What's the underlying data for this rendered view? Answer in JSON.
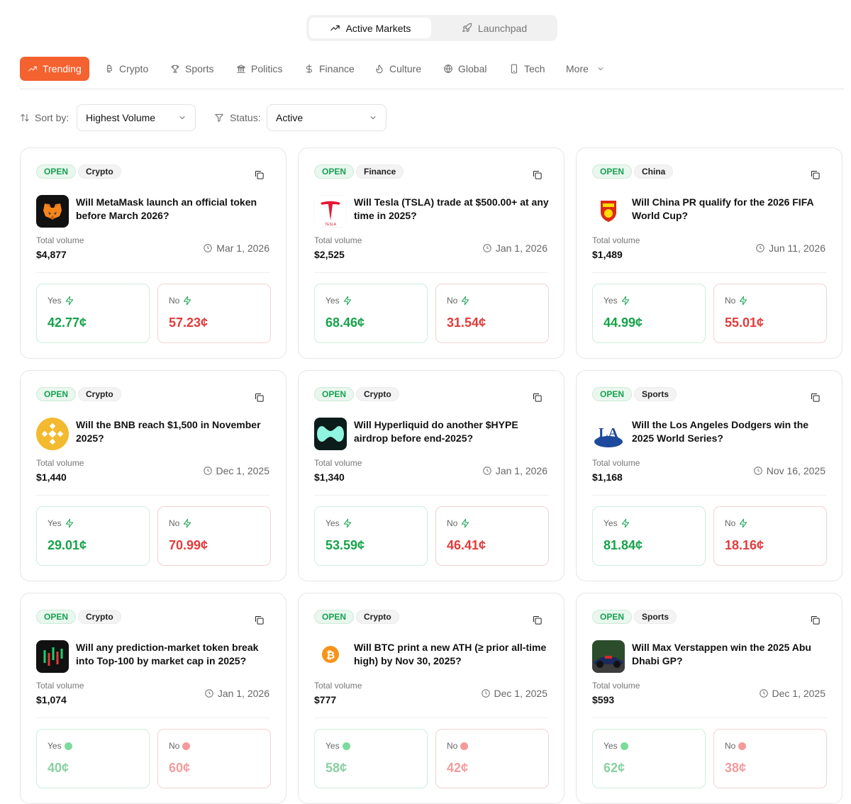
{
  "top_tabs": [
    {
      "label": "Active Markets",
      "icon": "trending-up-icon"
    },
    {
      "label": "Launchpad",
      "icon": "rocket-icon"
    }
  ],
  "categories": [
    {
      "label": "Trending",
      "icon": "trending-up-icon"
    },
    {
      "label": "Crypto",
      "icon": "bitcoin-icon"
    },
    {
      "label": "Sports",
      "icon": "trophy-icon"
    },
    {
      "label": "Politics",
      "icon": "landmark-icon"
    },
    {
      "label": "Finance",
      "icon": "dollar-icon"
    },
    {
      "label": "Culture",
      "icon": "flame-icon"
    },
    {
      "label": "Global",
      "icon": "globe-icon"
    },
    {
      "label": "Tech",
      "icon": "phone-icon"
    },
    {
      "label": "More",
      "icon": "chevron-down-icon"
    }
  ],
  "filters": {
    "sort_label": "Sort by:",
    "sort_value": "Highest Volume",
    "status_label": "Status:",
    "status_value": "Active"
  },
  "volume_label": "Total volume",
  "yes_label": "Yes",
  "no_label": "No",
  "colors": {
    "accent": "#f4622f",
    "yes": "#16a34a",
    "no": "#e23b3b"
  },
  "markets": [
    {
      "status": "OPEN",
      "category": "Crypto",
      "logo": "metamask-logo",
      "question": "Will MetaMask launch an official token before March 2026?",
      "volume": "$4,877",
      "date": "Mar 1, 2026",
      "yes": "42.77¢",
      "no": "57.23¢",
      "indicator": "bolt"
    },
    {
      "status": "OPEN",
      "category": "Finance",
      "logo": "tesla-logo",
      "question": "Will Tesla (TSLA) trade at $500.00+ at any time in 2025?",
      "volume": "$2,525",
      "date": "Jan 1, 2026",
      "yes": "68.46¢",
      "no": "31.54¢",
      "indicator": "bolt"
    },
    {
      "status": "OPEN",
      "category": "China",
      "logo": "china-fa-logo",
      "question": "Will China PR qualify for the 2026 FIFA World Cup?",
      "volume": "$1,489",
      "date": "Jun 11, 2026",
      "yes": "44.99¢",
      "no": "55.01¢",
      "indicator": "bolt"
    },
    {
      "status": "OPEN",
      "category": "Crypto",
      "logo": "bnb-logo",
      "question": "Will the BNB reach $1,500 in November 2025?",
      "volume": "$1,440",
      "date": "Dec 1, 2025",
      "yes": "29.01¢",
      "no": "70.99¢",
      "indicator": "bolt"
    },
    {
      "status": "OPEN",
      "category": "Crypto",
      "logo": "hyperliquid-logo",
      "question": "Will Hyperliquid do another $HYPE airdrop before end-2025?",
      "volume": "$1,340",
      "date": "Jan 1, 2026",
      "yes": "53.59¢",
      "no": "46.41¢",
      "indicator": "bolt"
    },
    {
      "status": "OPEN",
      "category": "Sports",
      "logo": "dodgers-logo",
      "question": "Will the Los Angeles Dodgers win the 2025 World Series?",
      "volume": "$1,168",
      "date": "Nov 16, 2025",
      "yes": "81.84¢",
      "no": "18.16¢",
      "indicator": "bolt"
    },
    {
      "status": "OPEN",
      "category": "Crypto",
      "logo": "candlestick-logo",
      "question": "Will any prediction-market token break into Top-100 by market cap in 2025?",
      "volume": "$1,074",
      "date": "Jan 1, 2026",
      "yes": "40¢",
      "no": "60¢",
      "indicator": "dot"
    },
    {
      "status": "OPEN",
      "category": "Crypto",
      "logo": "bitcoin-logo",
      "question": "Will BTC print a new ATH (≥ prior all-time high) by Nov 30, 2025?",
      "volume": "$777",
      "date": "Dec 1, 2025",
      "yes": "58¢",
      "no": "42¢",
      "indicator": "dot"
    },
    {
      "status": "OPEN",
      "category": "Sports",
      "logo": "f1-car-logo",
      "question": "Will Max Verstappen win the 2025 Abu Dhabi GP?",
      "volume": "$593",
      "date": "Dec 1, 2025",
      "yes": "62¢",
      "no": "38¢",
      "indicator": "dot"
    }
  ]
}
